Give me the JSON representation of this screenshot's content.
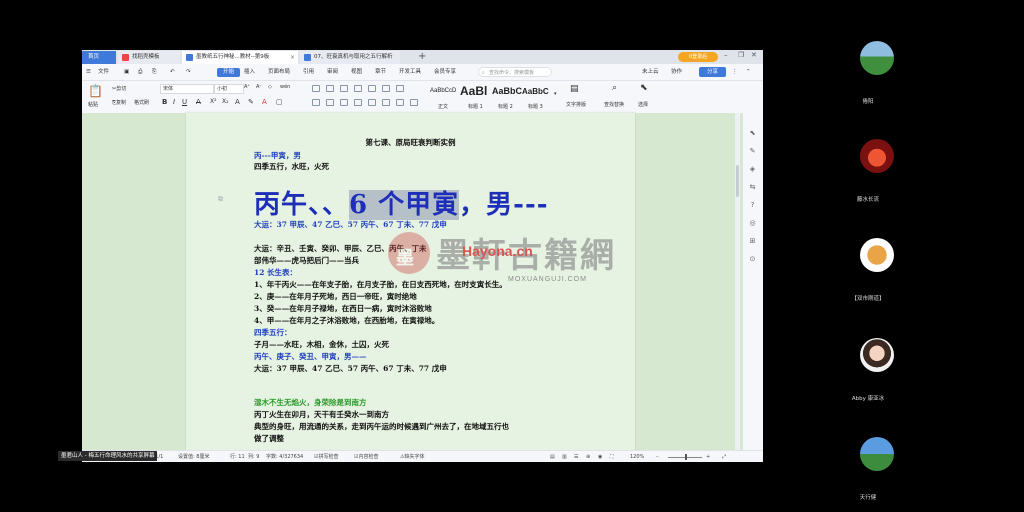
{
  "tabs": {
    "home": "首页",
    "t1": "找稻壳模板",
    "t2": "墨教纸五行神秘...教材--第9板",
    "t3": "07、旺衰真机与取用之五行解析"
  },
  "user_badge": "0登录后",
  "menu": {
    "file": "文件",
    "start": "开始",
    "insert": "插入",
    "layout": "页面布局",
    "reference": "引用",
    "review": "审阅",
    "view": "视图",
    "section": "章节",
    "dev": "开发工具",
    "member": "会员专享",
    "search_placeholder": "查找命令、搜索模板",
    "cloud": "未上云",
    "collab": "协作",
    "share": "分享"
  },
  "ribbon": {
    "paste": "粘贴",
    "cut": "剪切",
    "copy": "复制",
    "format_painter": "格式刷",
    "font": "宋体",
    "size": "小初",
    "styles": [
      "AaBbCcD",
      "AaBl",
      "AaBbC",
      "AaBbC"
    ],
    "style_names": [
      "正文",
      "标题 1",
      "标题 2",
      "标题 3"
    ],
    "text_layout": "文字排版",
    "find_replace": "查找替换",
    "select": "选择"
  },
  "doc": {
    "heading": "第七课、原局旺衰判断实例",
    "l1": "丙---甲寅，男",
    "l2": "四季五行，水旺，火死",
    "big_prefix": "丙午、、",
    "big_highlight": "6 个甲寅",
    "big_suffix": "，男---",
    "l3": "大运：37 甲辰、47 乙巳、57 丙午、67 丁未、77 戊申",
    "l4": "大运：辛丑、壬寅、癸卯、甲辰、乙巳、丙午、丁未",
    "l5": "部伟华——虎马把后门——当兵",
    "l6": "12 长生表：",
    "l7": "1、年干丙火——在年支子胎，在月支子胎，在日支西死地，在时支寅长生。",
    "l8": "2、庚——在年月子死地，西日一帝旺，寅时绝地",
    "l9": "3、癸——在年月子禄地，在西日一病，寅时沐浴败地",
    "l10": "4、甲——在年月之子沐浴败地，在西胎地，在寅禄地。",
    "l11": "四季五行：",
    "l12": "子月——水旺，木相，金休，土囚，火死",
    "l13": "丙午、庚子、癸丑、甲寅，男——",
    "l14": "大运：37 甲辰、47 乙巳、57 丙午、67 丁未、77 戊申",
    "l15": "湿木不生无焰火，身荣除是到南方",
    "l16": "丙丁火生在卯月，天干有壬癸水一到南方",
    "l17": "典型的身旺，用流通的关系，走到丙午运的时候遇到广州去了，在地域五行也",
    "l18": "做了调整"
  },
  "watermark": {
    "seal": "墨",
    "cn": "墨軒古籍網",
    "url": "Hayona.cn",
    "sub": "MOXUANGUJI.COM"
  },
  "status": {
    "page": "页码: 1",
    "pages": "页面: 1/1",
    "setting": "设置值: 8厘米",
    "row": "行: 11",
    "col": "列: 9",
    "words": "字数: 4/327634",
    "spell": "拼写检查",
    "content_check": "内容检查",
    "missing_font": "缺失字体",
    "zoom": "120%"
  },
  "presenter": "墨君山人 - 梅五行命理风水的共享屏幕",
  "participants": [
    {
      "name": "倦阳"
    },
    {
      "name": "藤水长流"
    },
    {
      "name": "【双市刚道】"
    },
    {
      "name": "Abby 康亚冰"
    },
    {
      "name": "天行健"
    }
  ]
}
